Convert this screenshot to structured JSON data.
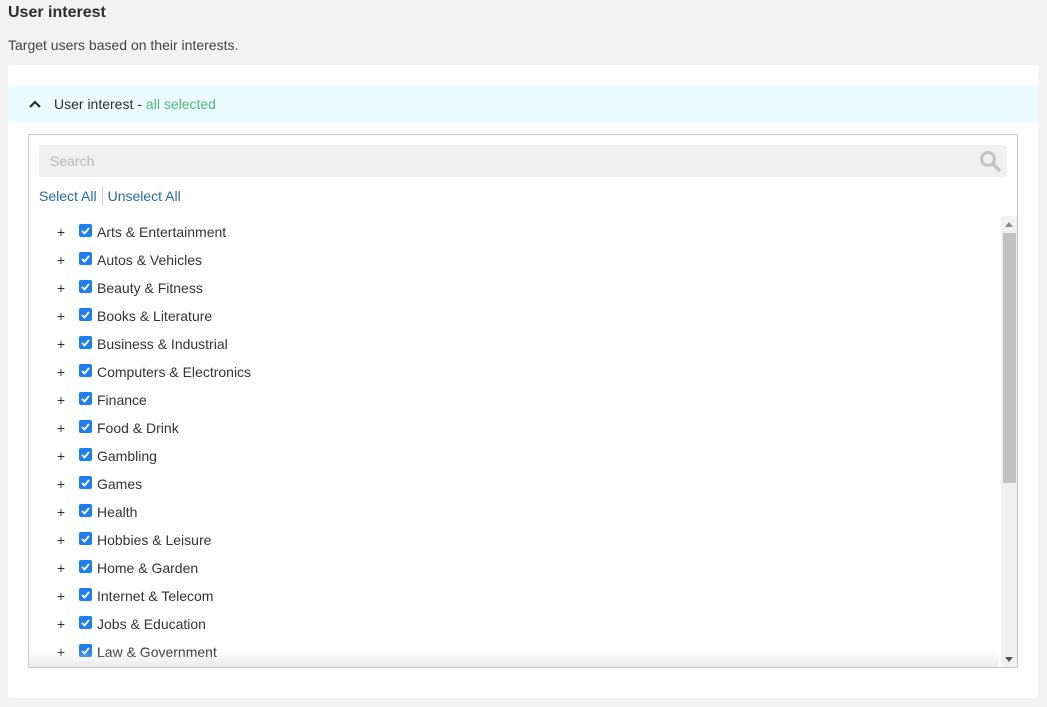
{
  "page": {
    "title": "User interest",
    "subtitle": "Target users based on their interests."
  },
  "section": {
    "title": "User interest -",
    "status": "all selected",
    "expanded": true
  },
  "search": {
    "placeholder": "Search",
    "value": ""
  },
  "actions": {
    "select_all": "Select All",
    "unselect_all": "Unselect All"
  },
  "colors": {
    "accent_blue": "#1e7ef0",
    "link_blue": "#2b6aa3",
    "status_green": "#4cb97c",
    "header_bg": "#ecfbfe"
  },
  "interests": [
    {
      "label": "Arts & Entertainment",
      "checked": true
    },
    {
      "label": "Autos & Vehicles",
      "checked": true
    },
    {
      "label": "Beauty & Fitness",
      "checked": true
    },
    {
      "label": "Books & Literature",
      "checked": true
    },
    {
      "label": "Business & Industrial",
      "checked": true
    },
    {
      "label": "Computers & Electronics",
      "checked": true
    },
    {
      "label": "Finance",
      "checked": true
    },
    {
      "label": "Food & Drink",
      "checked": true
    },
    {
      "label": "Gambling",
      "checked": true
    },
    {
      "label": "Games",
      "checked": true
    },
    {
      "label": "Health",
      "checked": true
    },
    {
      "label": "Hobbies & Leisure",
      "checked": true
    },
    {
      "label": "Home & Garden",
      "checked": true
    },
    {
      "label": "Internet & Telecom",
      "checked": true
    },
    {
      "label": "Jobs & Education",
      "checked": true
    },
    {
      "label": "Law & Government",
      "checked": true
    }
  ],
  "expand_symbol": "+"
}
